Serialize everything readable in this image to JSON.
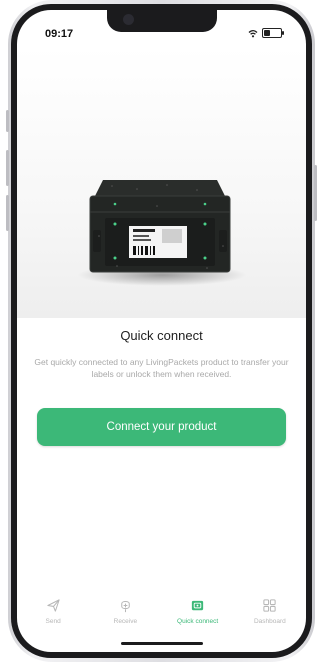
{
  "status_bar": {
    "time": "09:17"
  },
  "content": {
    "title": "Quick connect",
    "description": "Get quickly connected to any LivingPackets product to transfer your labels or unlock them when received.",
    "cta_label": "Connect your product"
  },
  "tabs": [
    {
      "label": "Send",
      "icon": "send-icon",
      "active": false
    },
    {
      "label": "Receive",
      "icon": "receive-icon",
      "active": false
    },
    {
      "label": "Quick connect",
      "icon": "quick-connect-icon",
      "active": true
    },
    {
      "label": "Dashboard",
      "icon": "dashboard-icon",
      "active": false
    }
  ],
  "colors": {
    "accent": "#3cb878",
    "inactive": "#b7b7b7",
    "text": "#1e1e1e",
    "muted": "#a9a9a9"
  }
}
